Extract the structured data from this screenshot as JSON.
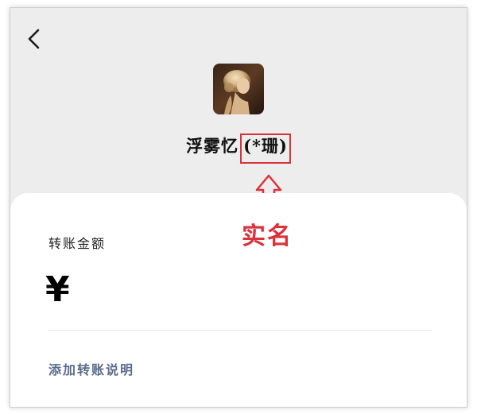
{
  "header": {
    "back_icon": "chevron-left-icon"
  },
  "payee": {
    "nickname": "浮雾忆",
    "real_name": "(*珊)",
    "avatar": "portrait-avatar"
  },
  "annotation": {
    "label": "实名",
    "color": "#d9323a",
    "arrow_icon": "up-arrow-outline-icon"
  },
  "transfer": {
    "amount_label": "转账金额",
    "currency_symbol": "¥",
    "amount_value": "",
    "add_note_label": "添加转账说明",
    "link_color": "#5b6b8e"
  }
}
